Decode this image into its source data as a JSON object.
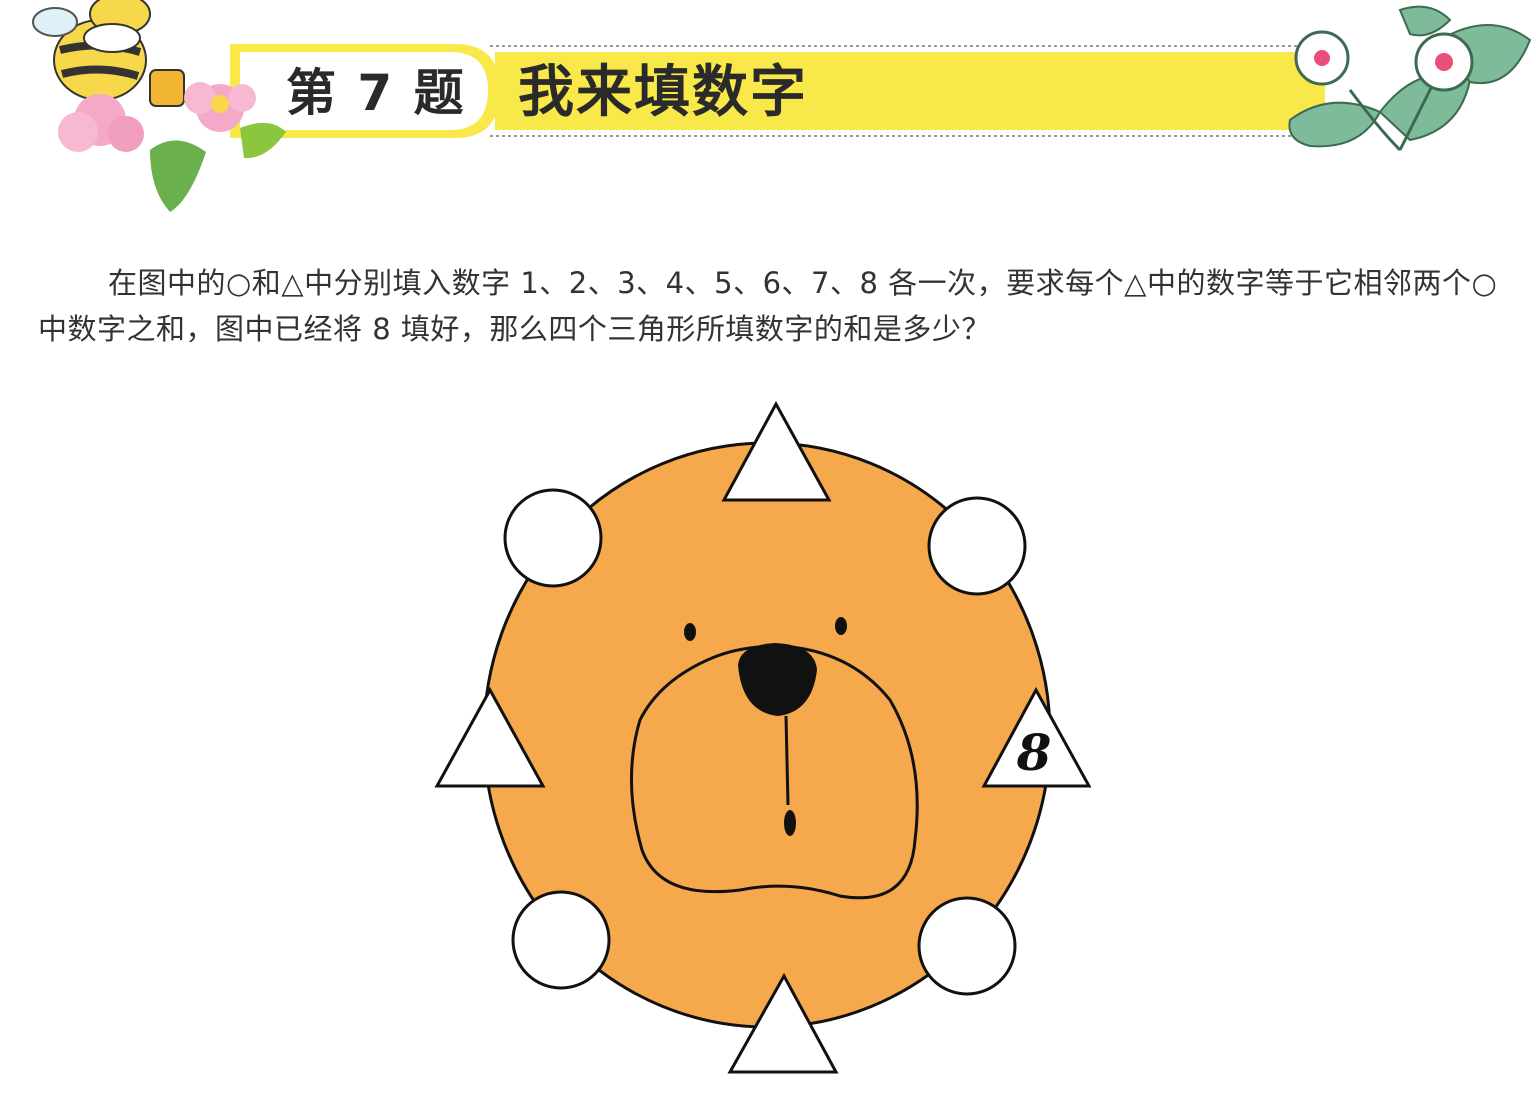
{
  "header": {
    "question_number": "第 7 题",
    "title": "我来填数字"
  },
  "problem": {
    "text": "在图中的○和△中分别填入数字 1、2、3、4、5、6、7、8 各一次，要求每个△中的数字等于它相邻两个○中数字之和，图中已经将 8 填好，那么四个三角形所填数字的和是多少？"
  },
  "diagram": {
    "given_value": "8",
    "colors": {
      "face": "#f5a84c",
      "banner": "#f8e84a",
      "outline": "#111111"
    }
  }
}
